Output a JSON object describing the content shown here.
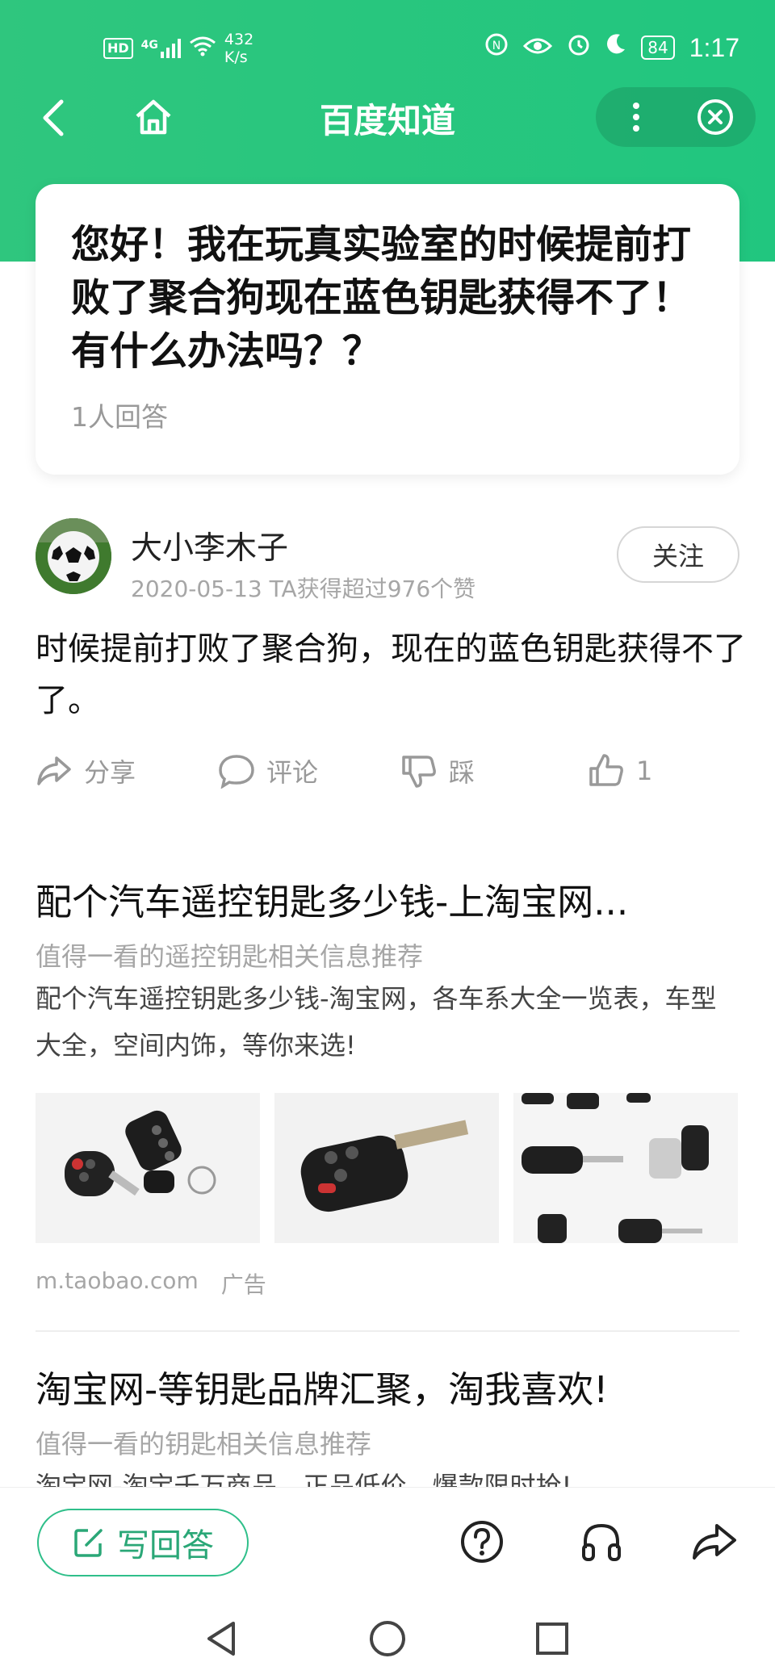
{
  "status_bar": {
    "hd": "HD",
    "signal": "4G",
    "net_speed_value": "432",
    "net_speed_unit": "K/s",
    "battery": "84",
    "time": "1:17"
  },
  "nav": {
    "title": "百度知道"
  },
  "question": {
    "title": "您好！我在玩真实验室的时候提前打败了聚合狗现在蓝色钥匙获得不了！有什么办法吗？？",
    "answer_count": "1人回答"
  },
  "answer": {
    "author_name": "大小李木子",
    "author_meta": "2020-05-13 TA获得超过976个赞",
    "follow_label": "关注",
    "text": "时候提前打败了聚合狗，现在的蓝色钥匙获得不了了。",
    "actions": {
      "share": "分享",
      "comment": "评论",
      "dislike": "踩",
      "like_count": "1"
    }
  },
  "ads": [
    {
      "title": "配个汽车遥控钥匙多少钱-上淘宝网...",
      "subtitle": "值得一看的遥控钥匙相关信息推荐",
      "description": "配个汽车遥控钥匙多少钱-淘宝网，各车系大全一览表，车型大全，空间内饰，等你来选!",
      "source": "m.taobao.com",
      "tag": "广告"
    },
    {
      "title": "淘宝网-等钥匙品牌汇聚，淘我喜欢!",
      "subtitle": "值得一看的钥匙相关信息推荐",
      "description": "淘宝网-淘宝千万商品，正品低价，爆款限时抢!"
    }
  ],
  "bottom_bar": {
    "write_answer": "写回答"
  },
  "colors": {
    "brand_green": "#2fc67e",
    "accent_green": "#2aa777"
  }
}
